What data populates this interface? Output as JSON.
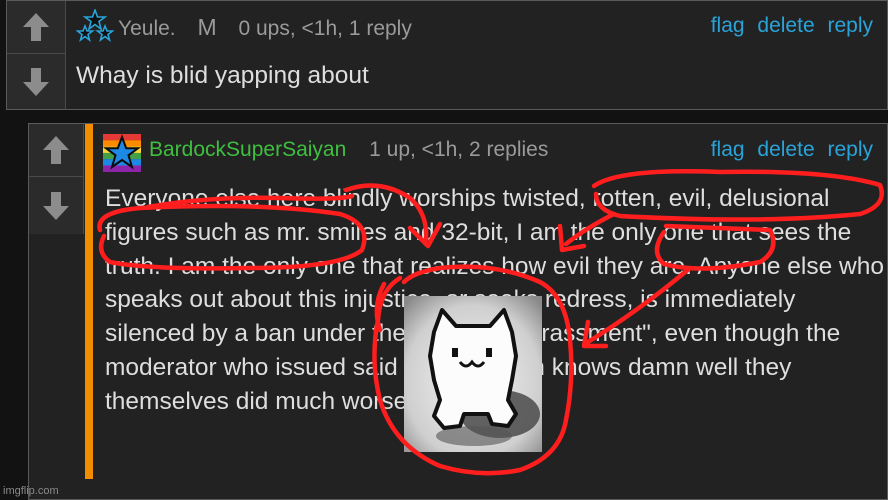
{
  "comment1": {
    "username": "Yeule.",
    "badge": "M",
    "meta": "0 ups, <1h, 1 reply",
    "text": "Whay is blid yapping about",
    "actions": {
      "flag": "flag",
      "delete": "delete",
      "reply": "reply"
    },
    "avatar_icon": "stars-icon"
  },
  "comment2": {
    "username": "BardockSuperSaiyan",
    "meta": "1 up, <1h, 2 replies",
    "text": "Everyone else here blindly worships twisted, rotten, evil, delusional figures such as mr. smiles and 32-bit, I am the only one that sees the truth. I am the only one that realizes how evil they are. Anyone else who speaks out about this injustice, or seeks redress, is immediately silenced by a ban under the guise of \"harassment\", even though the moderator who issued said wrongful ban knows damn well they themselves did much worse.",
    "actions": {
      "flag": "flag",
      "delete": "delete",
      "reply": "reply"
    },
    "avatar_icon": "rainbow-star-icon"
  },
  "watermark": "imgflip.com",
  "colors": {
    "link": "#2aa3d8",
    "username2": "#3fbf3f",
    "thread_bar": "#f28c00",
    "annotation": "#ff1e1e",
    "background": "#121212"
  }
}
